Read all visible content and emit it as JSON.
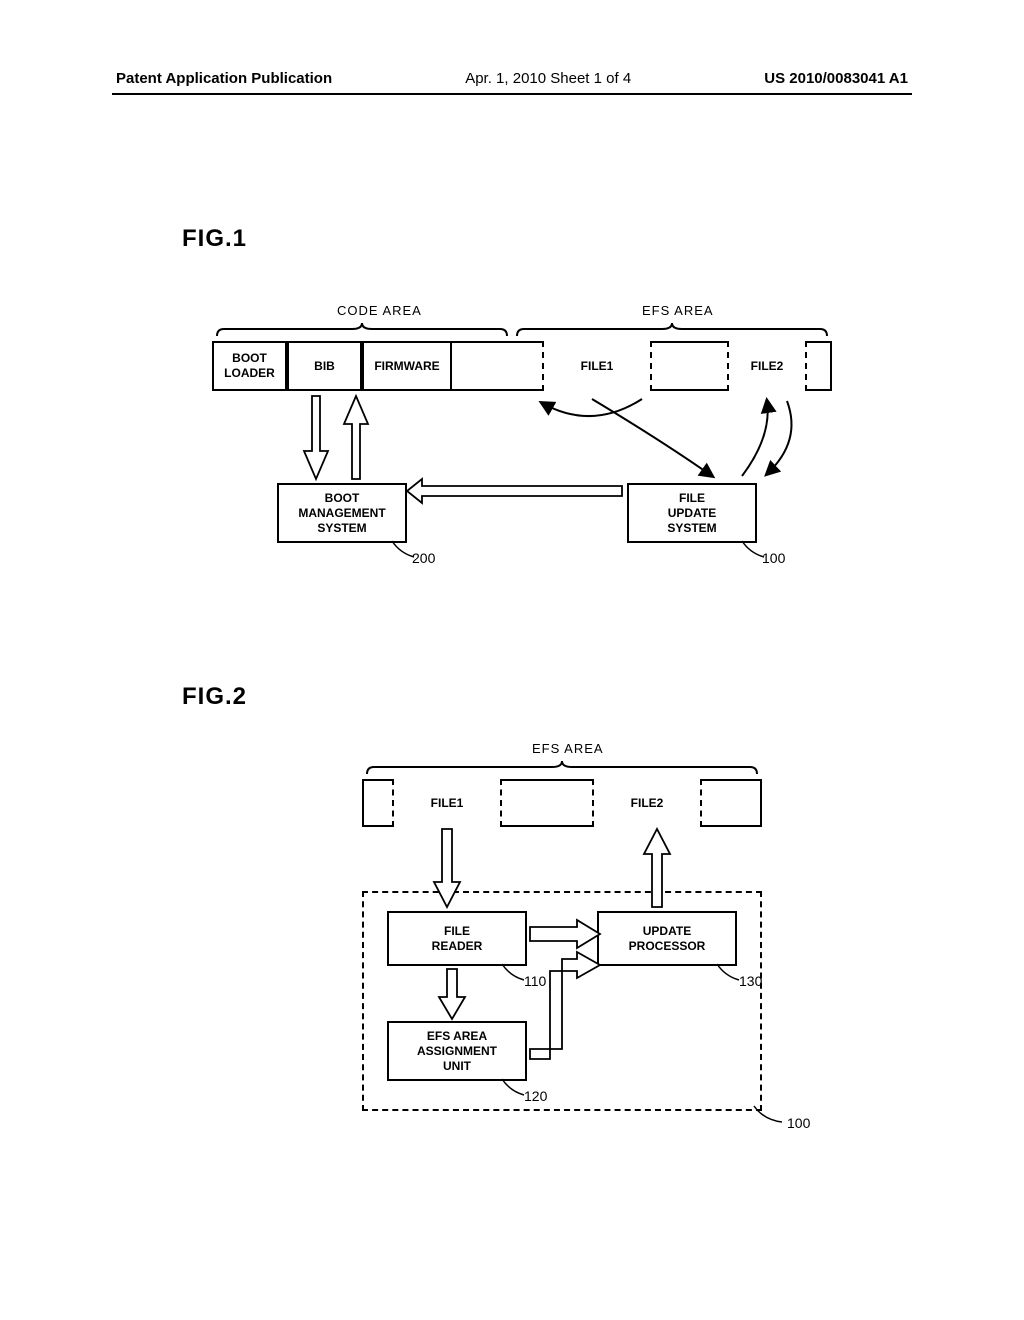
{
  "header": {
    "left": "Patent Application Publication",
    "mid": "Apr. 1, 2010  Sheet 1 of 4",
    "right": "US 2010/0083041 A1"
  },
  "fig1": {
    "label": "FIG.1",
    "code_area": "CODE AREA",
    "efs_area": "EFS AREA",
    "boot_loader": "BOOT\nLOADER",
    "bib": "BIB",
    "firmware": "FIRMWARE",
    "file1": "FILE1",
    "file2": "FILE2",
    "boot_mgmt": "BOOT\nMANAGEMENT\nSYSTEM",
    "file_update": "FILE\nUPDATE\nSYSTEM",
    "ref200": "200",
    "ref100": "100"
  },
  "fig2": {
    "label": "FIG.2",
    "efs_area": "EFS AREA",
    "file1": "FILE1",
    "file2": "FILE2",
    "file_reader": "FILE\nREADER",
    "update_processor": "UPDATE\nPROCESSOR",
    "efs_unit": "EFS AREA\nASSIGNMENT\nUNIT",
    "ref110": "110",
    "ref120": "120",
    "ref130": "130",
    "ref100": "100"
  }
}
